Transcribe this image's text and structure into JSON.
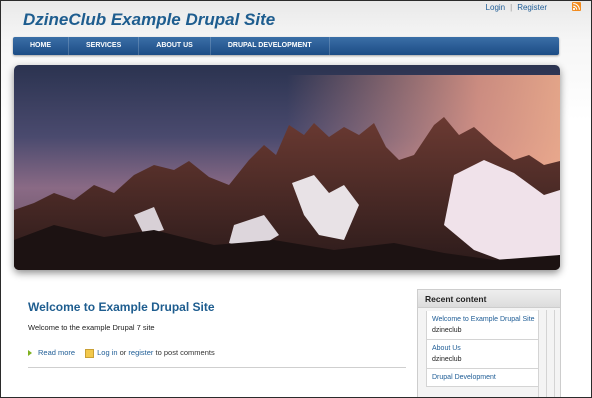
{
  "header": {
    "site_name": "DzineClub Example Drupal Site",
    "login": "Login",
    "separator": "|",
    "register": "Register",
    "rss_icon": "rss-feed-icon"
  },
  "nav": {
    "items": [
      "HOME",
      "SERVICES",
      "ABOUT US",
      "DRUPAL DEVELOPMENT"
    ]
  },
  "banner": {
    "image_description_icon": "mountain-sunset-image"
  },
  "main": {
    "title": "Welcome to Example Drupal Site",
    "body": "Welcome to the example Drupal 7 site",
    "read_more": "Read more",
    "log_in": "Log in",
    "or": "or",
    "register": "register",
    "to_post": "to post comments"
  },
  "sidebar": {
    "title": "Recent content",
    "items": [
      {
        "title": "Welcome to Example Drupal Site",
        "author": "dzineclub"
      },
      {
        "title": "About Us",
        "author": "dzineclub"
      },
      {
        "title": "Drupal Development",
        "author": ""
      }
    ]
  },
  "colors": {
    "brand_blue": "#1e5d8f",
    "nav_bg": "#2a5d96",
    "link": "#1f5d96"
  }
}
